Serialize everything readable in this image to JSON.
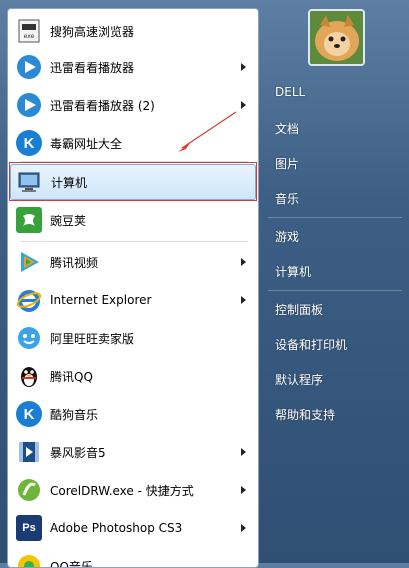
{
  "left_menu": [
    {
      "label": "搜狗高速浏览器",
      "icon": "sogou-browser-icon",
      "has_submenu": false
    },
    {
      "label": "迅雷看看播放器",
      "icon": "xunlei-player-icon",
      "has_submenu": true
    },
    {
      "label": "迅雷看看播放器 (2)",
      "icon": "xunlei-player-icon",
      "has_submenu": true
    },
    {
      "label": "毒霸网址大全",
      "icon": "duba-icon",
      "has_submenu": false
    },
    {
      "label": "计算机",
      "icon": "computer-icon",
      "has_submenu": false,
      "selected": true
    },
    {
      "label": "豌豆荚",
      "icon": "wandoujia-icon",
      "has_submenu": false
    },
    {
      "label": "腾讯视频",
      "icon": "tencent-video-icon",
      "has_submenu": true
    },
    {
      "label": "Internet Explorer",
      "icon": "internet-explorer-icon",
      "has_submenu": true
    },
    {
      "label": "阿里旺旺卖家版",
      "icon": "aliwangwang-icon",
      "has_submenu": false
    },
    {
      "label": "腾讯QQ",
      "icon": "qq-penguin-icon",
      "has_submenu": false
    },
    {
      "label": "酷狗音乐",
      "icon": "kugou-music-icon",
      "has_submenu": false
    },
    {
      "label": "暴风影音5",
      "icon": "baofeng-player-icon",
      "has_submenu": true
    },
    {
      "label": "CorelDRW.exe - 快捷方式",
      "icon": "coreldraw-icon",
      "has_submenu": true
    },
    {
      "label": "Adobe Photoshop CS3",
      "icon": "photoshop-icon",
      "has_submenu": true
    },
    {
      "label": "QQ音乐",
      "icon": "qq-music-icon",
      "has_submenu": false
    }
  ],
  "right_links": [
    "DELL",
    "文档",
    "图片",
    "音乐",
    "游戏",
    "计算机",
    "控制面板",
    "设备和打印机",
    "默认程序",
    "帮助和支持"
  ],
  "user_avatar": "pomeranian-dog-avatar",
  "colors": {
    "highlight": "#84acdd",
    "annotation": "#d23c3c",
    "pane_bg": "#3d5f85"
  }
}
